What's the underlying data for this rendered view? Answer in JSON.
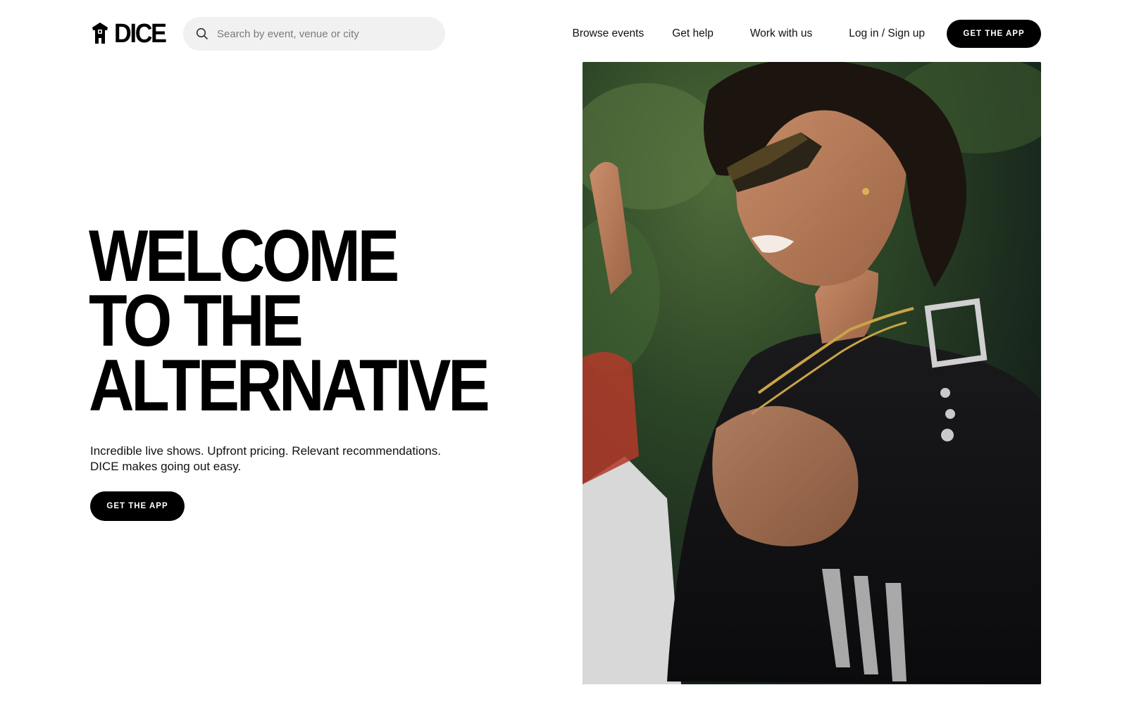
{
  "brand": {
    "name": "DICE",
    "logo_icon": "dice-hood-icon"
  },
  "search": {
    "placeholder": "Search by event, venue or city",
    "icon": "search-icon"
  },
  "nav": {
    "items": [
      {
        "label": "Browse events"
      },
      {
        "label": "Get help"
      },
      {
        "label": "Work with us"
      },
      {
        "label": "Log in / Sign up"
      }
    ],
    "cta_label": "GET THE APP"
  },
  "hero": {
    "title_lines": [
      "WELCOME",
      "TO THE",
      "ALTERNATIVE"
    ],
    "subtitle_lines": [
      "Incredible live shows. Upfront pricing. Relevant recommendations.",
      "DICE makes going out easy."
    ],
    "cta_label": "GET THE APP"
  },
  "colors": {
    "background": "#ffffff",
    "text": "#000000",
    "button_bg": "#000000",
    "button_text": "#ffffff",
    "search_bg": "#f1f1f1"
  }
}
